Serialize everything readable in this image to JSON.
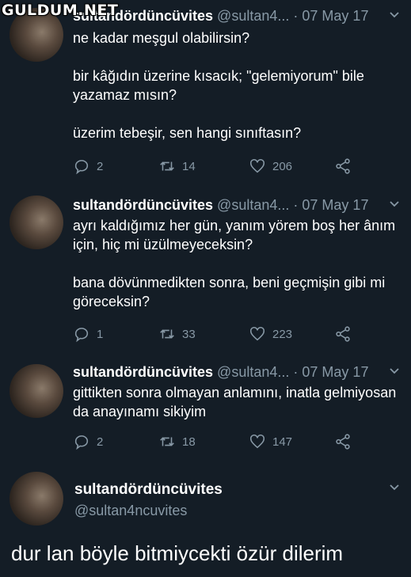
{
  "watermark": "GULDUM.NET",
  "tweets": [
    {
      "name": "sultandördüncüvites",
      "handle": "@sultan4...",
      "sep": "·",
      "time": "07 May 17",
      "paragraphs": [
        "ne kadar meşgul olabilirsin?",
        "bir kâğıdın üzerine kısacık; \"gelemiyorum\" bile yazamaz mısın?",
        "üzerim tebeşir, sen hangi sınıftasın?"
      ],
      "replies": "2",
      "retweets": "14",
      "likes": "206"
    },
    {
      "name": "sultandördüncüvites",
      "handle": "@sultan4...",
      "sep": "·",
      "time": "07 May 17",
      "paragraphs": [
        "ayrı kaldığımız her gün, yanım yörem boş her ânım için, hiç mi üzülmeyeceksin?",
        "bana dövünmedikten sonra, beni geçmişin gibi mi göreceksin?"
      ],
      "replies": "1",
      "retweets": "33",
      "likes": "223"
    },
    {
      "name": "sultandördüncüvites",
      "handle": "@sultan4...",
      "sep": "·",
      "time": "07 May 17",
      "paragraphs": [
        "gittikten sonra olmayan anlamını, inatla gelmiyosan da anayınamı sikiyim"
      ],
      "replies": "2",
      "retweets": "18",
      "likes": "147"
    }
  ],
  "final": {
    "name": "sultandördüncüvites",
    "handle": "@sultan4ncuvites",
    "text": "dur lan böyle bitmiycekti özür dilerim"
  },
  "icons": [
    "reply-icon",
    "retweet-icon",
    "like-icon",
    "share-icon",
    "chevron-down-icon"
  ]
}
